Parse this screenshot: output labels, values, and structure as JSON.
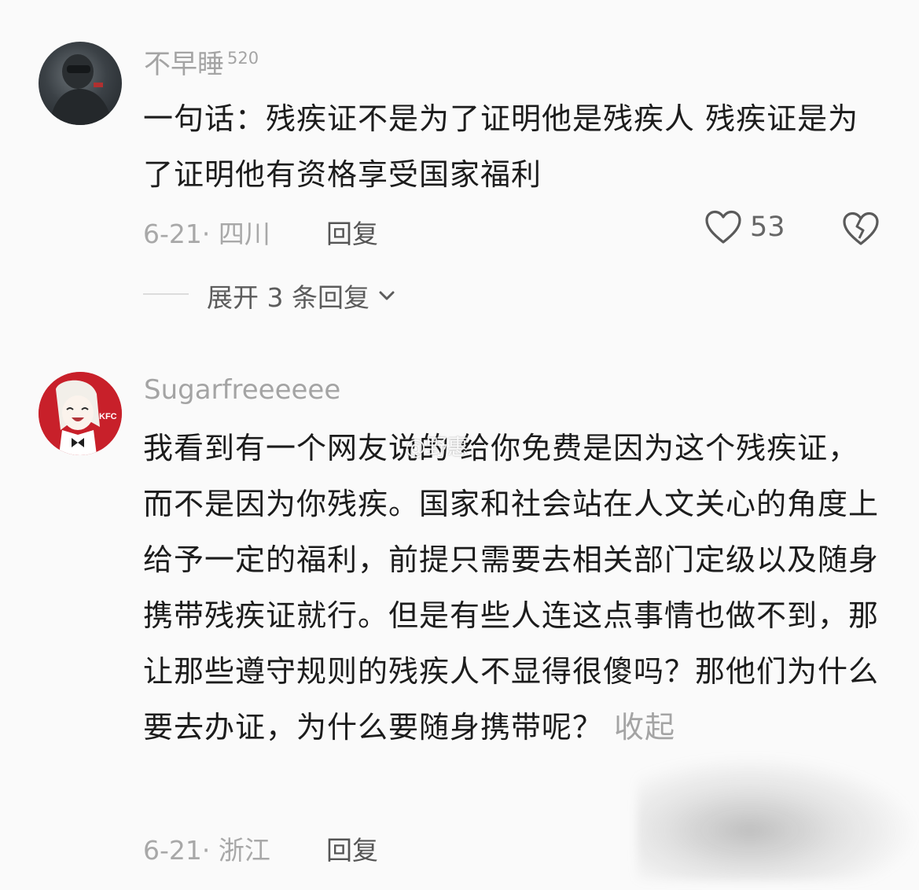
{
  "comments": [
    {
      "username": "不早睡",
      "level": "520",
      "text": "一句话：残疾证不是为了证明他是残疾人 残疾证是为了证明他有资格享受国家福利",
      "meta": "6-21· 四川",
      "reply_label": "回复",
      "like_count": "53",
      "expand_label": "展开 3 条回复"
    },
    {
      "username": "Sugarfreeeeee",
      "text": "我看到有一个网友说的 给你免费是因为这个残疾证，而不是因为你残疾。国家和社会站在人文关心的角度上给予一定的福利，前提只需要去相关部门定级以及随身携带残疾证就行。但是有些人连这点事情也做不到，那让那些遵守规则的残疾人不显得很傻吗？那他们为什么要去办证，为什么要随身携带呢？",
      "collapse_label": "收起",
      "meta": "6-21· 浙江",
      "reply_label": "回复",
      "avatar_badge": "KFC"
    }
  ],
  "watermark": "@野惠",
  "icons": {
    "like": "heart-outline-icon",
    "dislike": "broken-heart-icon",
    "expand": "chevron-down-icon"
  },
  "colors": {
    "background": "#fafafa",
    "secondary_text": "#a4a4a4",
    "kfc_red": "#c8202a"
  }
}
